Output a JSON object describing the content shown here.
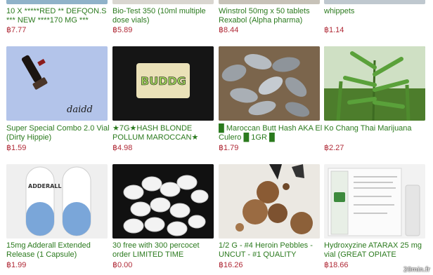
{
  "listings_row0": [
    {
      "title": "10 X *****RED ** DEFQON.S *** NEW ****170 MG ***",
      "price": "฿7.77"
    },
    {
      "title": "Bio-Test 350 (10ml multiple dose vials)",
      "price": "฿5.89"
    },
    {
      "title": "Winstrol 50mg x 50 tablets Rexabol (Alpha pharma)",
      "price": "฿8.44"
    },
    {
      "title": "whippets",
      "price": "฿1.14"
    }
  ],
  "listings_row1": [
    {
      "title": "Super Special Combo 2.0 Vial (Dirty Hippie)",
      "price": "฿1.59",
      "image_text": "daidd"
    },
    {
      "title": "★7G★HASH BLONDE POLLUM MAROCCAN★",
      "price": "฿4.98",
      "image_text": "BUDDG"
    },
    {
      "title": "█ Maroccan Butt Hash AKA El Culero █ 1GR █",
      "price": "฿1.79"
    },
    {
      "title": "Ko Chang Thai Marijuana",
      "price": "฿2.27"
    }
  ],
  "listings_row2": [
    {
      "title": "15mg Adderall Extended Release (1 Capsule)",
      "price": "฿1.99",
      "image_text": "ADDERALL XR"
    },
    {
      "title": "30 free with 300 percocet order LIMITED TIME",
      "price": "฿0.00"
    },
    {
      "title": "1/2 G - #4 Heroin Pebbles - UNCUT - #1 QUALITY",
      "price": "฿16.26"
    },
    {
      "title": "Hydroxyzine ATARAX 25 mg vial (GREAT OPIATE",
      "price": "฿18.66"
    }
  ],
  "watermark": "20min.fr",
  "colors": {
    "title": "#2b7a1e",
    "price": "#b02a37"
  }
}
